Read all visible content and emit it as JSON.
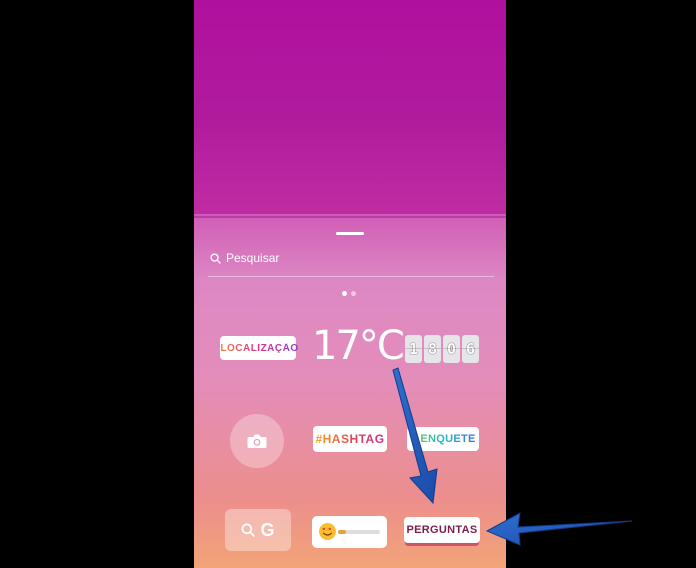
{
  "search": {
    "placeholder": "Pesquisar"
  },
  "pager": {
    "current": 1,
    "total": 2
  },
  "stickers": {
    "location": "LOCALIZAÇÃO",
    "temperature": "17°C",
    "clock_digits": [
      "1",
      "8",
      "0",
      "6"
    ],
    "hashtag": "#HASHTAG",
    "poll": "≡ ENQUETE",
    "gif_label": "G",
    "questions": "PERGUNTAS"
  },
  "icons": {
    "search": "search-icon",
    "location_pin": "location-pin-icon",
    "camera": "camera-icon",
    "gif_search": "search-icon",
    "emoji_slider": "heart-eyes-emoji-icon",
    "annotation": "arrow-annotation"
  },
  "colors": {
    "top_gradient": "#b0109e",
    "tray_bottom": "#f3a478",
    "arrow": "#1e56b8"
  }
}
